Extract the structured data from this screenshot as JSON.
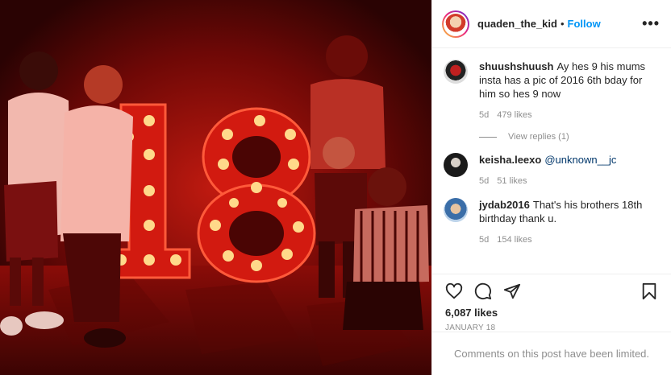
{
  "post": {
    "username": "quaden_the_kid",
    "dot": "•",
    "follow_label": "Follow",
    "more_label": "•••",
    "likes": "6,087 likes",
    "date": "JANUARY 18",
    "limited_notice": "Comments on this post have been limited."
  },
  "comments": [
    {
      "user": "shuushshuush",
      "text": "Ay hes 9 his mums insta has a pic of 2016 6th bday for him so hes 9 now",
      "age": "5d",
      "likes": "479 likes",
      "replies": "View replies (1)"
    },
    {
      "user": "keisha.leexo",
      "text": "@unknown__jc",
      "age": "5d",
      "likes": "51 likes"
    },
    {
      "user": "jydab2016",
      "text": "That's his brothers 18th birthday thank u.",
      "age": "5d",
      "likes": "154 likes"
    }
  ],
  "photo": {
    "sign_text": "18"
  },
  "colors": {
    "accent": "#0095f6",
    "muted": "#8e8e8e",
    "photo_bg": "#2a0303",
    "bulb": "#ffd98a"
  },
  "icons": [
    "heart-icon",
    "comment-icon",
    "share-icon",
    "bookmark-icon",
    "more-options-icon"
  ]
}
